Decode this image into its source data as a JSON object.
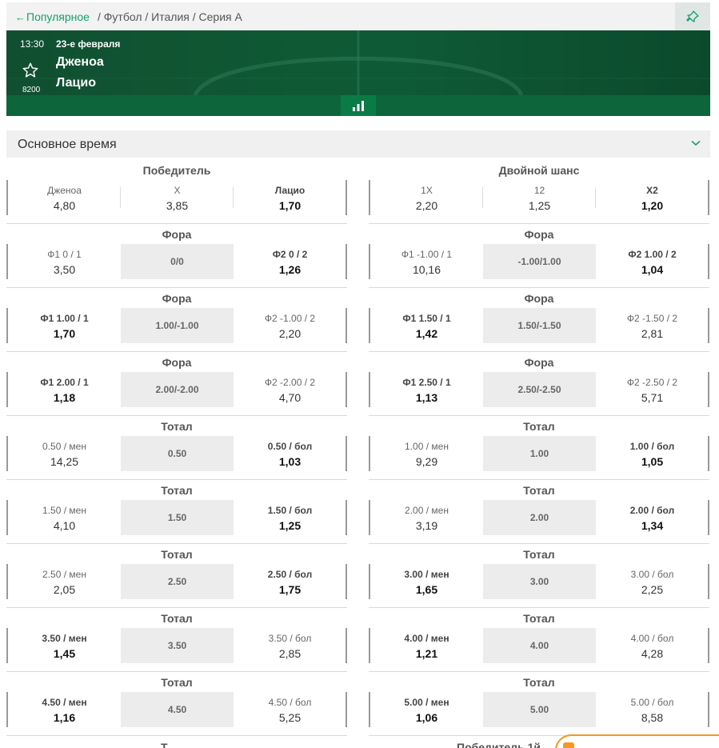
{
  "topbar": {
    "back_label": "Популярное",
    "breadcrumb": "/ Футбол / Италия / Серия А"
  },
  "match": {
    "time": "13:30",
    "date": "23-е февраля",
    "team1": "Дженоа",
    "team2": "Лацио",
    "event_id": "8200"
  },
  "section": {
    "title": "Основное время"
  },
  "markets": [
    {
      "title": "Победитель",
      "cells": [
        {
          "label": "Дженоа",
          "value": "4,80",
          "bold": false
        },
        {
          "label": "X",
          "value": "3,85",
          "bold": false
        },
        {
          "label": "Лацио",
          "value": "1,70",
          "bold": true
        }
      ]
    },
    {
      "title": "Двойной шанс",
      "cells": [
        {
          "label": "1X",
          "value": "2,20",
          "bold": false
        },
        {
          "label": "12",
          "value": "1,25",
          "bold": false
        },
        {
          "label": "X2",
          "value": "1,20",
          "bold": true
        }
      ]
    },
    {
      "title": "Фора",
      "left": {
        "label": "Ф1 0 / 1",
        "value": "3,50",
        "bold": false
      },
      "center": "0/0",
      "right": {
        "label": "Ф2 0 / 2",
        "value": "1,26",
        "bold": true
      }
    },
    {
      "title": "Фора",
      "left": {
        "label": "Ф1 -1.00 / 1",
        "value": "10,16",
        "bold": false
      },
      "center": "-1.00/1.00",
      "right": {
        "label": "Ф2 1.00 / 2",
        "value": "1,04",
        "bold": true
      }
    },
    {
      "title": "Фора",
      "left": {
        "label": "Ф1 1.00 / 1",
        "value": "1,70",
        "bold": true
      },
      "center": "1.00/-1.00",
      "right": {
        "label": "Ф2 -1.00 / 2",
        "value": "2,20",
        "bold": false
      }
    },
    {
      "title": "Фора",
      "left": {
        "label": "Ф1 1.50 / 1",
        "value": "1,42",
        "bold": true
      },
      "center": "1.50/-1.50",
      "right": {
        "label": "Ф2 -1.50 / 2",
        "value": "2,81",
        "bold": false
      }
    },
    {
      "title": "Фора",
      "left": {
        "label": "Ф1 2.00 / 1",
        "value": "1,18",
        "bold": true
      },
      "center": "2.00/-2.00",
      "right": {
        "label": "Ф2 -2.00 / 2",
        "value": "4,70",
        "bold": false
      }
    },
    {
      "title": "Фора",
      "left": {
        "label": "Ф1 2.50 / 1",
        "value": "1,13",
        "bold": true
      },
      "center": "2.50/-2.50",
      "right": {
        "label": "Ф2 -2.50 / 2",
        "value": "5,71",
        "bold": false
      }
    },
    {
      "title": "Тотал",
      "left": {
        "label": "0.50 / мен",
        "value": "14,25",
        "bold": false
      },
      "center": "0.50",
      "right": {
        "label": "0.50 / бол",
        "value": "1,03",
        "bold": true
      }
    },
    {
      "title": "Тотал",
      "left": {
        "label": "1.00 / мен",
        "value": "9,29",
        "bold": false
      },
      "center": "1.00",
      "right": {
        "label": "1.00 / бол",
        "value": "1,05",
        "bold": true
      }
    },
    {
      "title": "Тотал",
      "left": {
        "label": "1.50 / мен",
        "value": "4,10",
        "bold": false
      },
      "center": "1.50",
      "right": {
        "label": "1.50 / бол",
        "value": "1,25",
        "bold": true
      }
    },
    {
      "title": "Тотал",
      "left": {
        "label": "2.00 / мен",
        "value": "3,19",
        "bold": false
      },
      "center": "2.00",
      "right": {
        "label": "2.00 / бол",
        "value": "1,34",
        "bold": true
      }
    },
    {
      "title": "Тотал",
      "left": {
        "label": "2.50 / мен",
        "value": "2,05",
        "bold": false
      },
      "center": "2.50",
      "right": {
        "label": "2.50 / бол",
        "value": "1,75",
        "bold": true
      }
    },
    {
      "title": "Тотал",
      "left": {
        "label": "3.00 / мен",
        "value": "1,65",
        "bold": true
      },
      "center": "3.00",
      "right": {
        "label": "3.00 / бол",
        "value": "2,25",
        "bold": false
      }
    },
    {
      "title": "Тотал",
      "left": {
        "label": "3.50 / мен",
        "value": "1,45",
        "bold": true
      },
      "center": "3.50",
      "right": {
        "label": "3.50 / бол",
        "value": "2,85",
        "bold": false
      }
    },
    {
      "title": "Тотал",
      "left": {
        "label": "4.00 / мен",
        "value": "1,21",
        "bold": true
      },
      "center": "4.00",
      "right": {
        "label": "4.00 / бол",
        "value": "4,28",
        "bold": false
      }
    },
    {
      "title": "Тотал",
      "left": {
        "label": "4.50 / мен",
        "value": "1,16",
        "bold": true
      },
      "center": "4.50",
      "right": {
        "label": "4.50 / бол",
        "value": "5,25",
        "bold": false
      }
    },
    {
      "title": "Тотал",
      "left": {
        "label": "5.00 / мен",
        "value": "1,06",
        "bold": true
      },
      "center": "5.00",
      "right": {
        "label": "5.00 / бол",
        "value": "8,58",
        "bold": false
      }
    }
  ],
  "cut_row": {
    "left_title": "Т",
    "right_title": "Победитель 1й"
  },
  "colors": {
    "accent": "#16a06a",
    "header_bg": "#0f5a35",
    "chat": "#f39a1f"
  }
}
